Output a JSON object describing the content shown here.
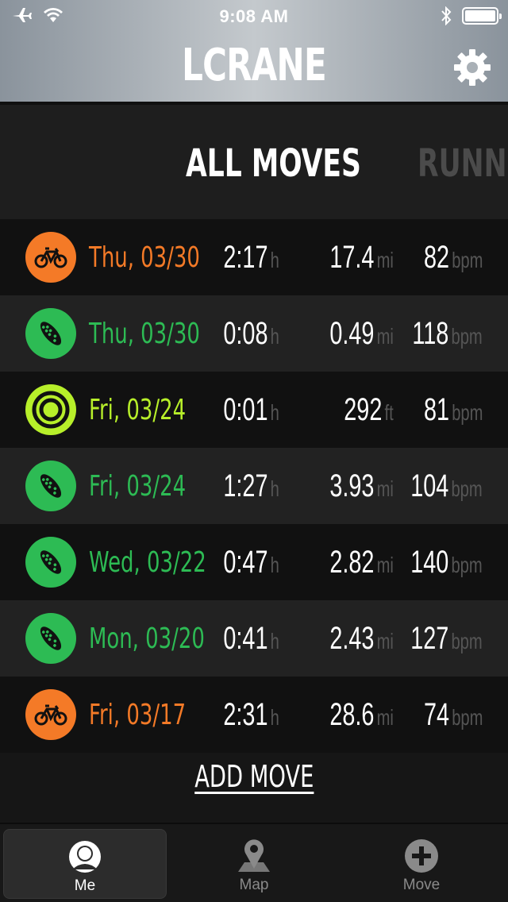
{
  "status": {
    "time": "9:08 AM",
    "icons": [
      "airplane-icon",
      "wifi-icon",
      "bluetooth-icon",
      "battery-icon"
    ]
  },
  "header": {
    "title": "LCRANE",
    "settings_icon": "gear-icon"
  },
  "tabs": [
    {
      "label": "ALL MOVES"
    },
    {
      "label": "RUNNIN"
    }
  ],
  "colors": {
    "cycling": "#f47a27",
    "running": "#2dbb54",
    "other": "#b7ef2a",
    "unit": "#555555"
  },
  "moves": [
    {
      "sport": "cycling",
      "icon": "bike-icon",
      "date": "Thu, 03/30",
      "duration": "2:17",
      "duration_unit": "h",
      "distance": "17.4",
      "distance_unit": "mi",
      "hr": "82",
      "hr_unit": "bpm"
    },
    {
      "sport": "running",
      "icon": "shoe-icon",
      "date": "Thu, 03/30",
      "duration": "0:08",
      "duration_unit": "h",
      "distance": "0.49",
      "distance_unit": "mi",
      "hr": "118",
      "hr_unit": "bpm"
    },
    {
      "sport": "other",
      "icon": "target-icon",
      "date": "Fri, 03/24",
      "duration": "0:01",
      "duration_unit": "h",
      "distance": "292",
      "distance_unit": "ft",
      "hr": "81",
      "hr_unit": "bpm"
    },
    {
      "sport": "running",
      "icon": "shoe-icon",
      "date": "Fri, 03/24",
      "duration": "1:27",
      "duration_unit": "h",
      "distance": "3.93",
      "distance_unit": "mi",
      "hr": "104",
      "hr_unit": "bpm"
    },
    {
      "sport": "running",
      "icon": "shoe-icon",
      "date": "Wed, 03/22",
      "duration": "0:47",
      "duration_unit": "h",
      "distance": "2.82",
      "distance_unit": "mi",
      "hr": "140",
      "hr_unit": "bpm"
    },
    {
      "sport": "running",
      "icon": "shoe-icon",
      "date": "Mon, 03/20",
      "duration": "0:41",
      "duration_unit": "h",
      "distance": "2.43",
      "distance_unit": "mi",
      "hr": "127",
      "hr_unit": "bpm"
    },
    {
      "sport": "cycling",
      "icon": "bike-icon",
      "date": "Fri, 03/17",
      "duration": "2:31",
      "duration_unit": "h",
      "distance": "28.6",
      "distance_unit": "mi",
      "hr": "74",
      "hr_unit": "bpm"
    }
  ],
  "add_move_label": "ADD MOVE",
  "nav": [
    {
      "label": "Me",
      "icon": "person-icon",
      "active": true
    },
    {
      "label": "Map",
      "icon": "map-pin-icon",
      "active": false
    },
    {
      "label": "Move",
      "icon": "plus-circle-icon",
      "active": false
    }
  ]
}
